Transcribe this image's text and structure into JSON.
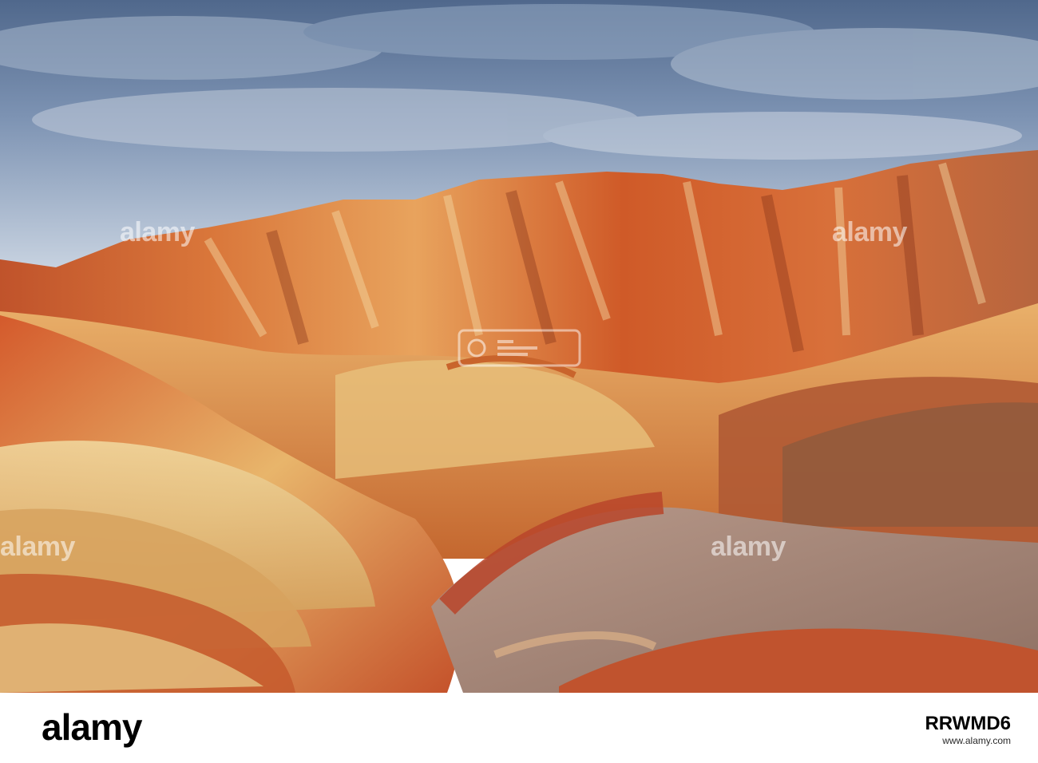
{
  "photo": {
    "subject": "rainbow-striped-badland-hills"
  },
  "watermarks": {
    "brand": "alamy"
  },
  "footer": {
    "logo": "alamy",
    "caption": "www.alamy.com",
    "image_id": "RRWMD6"
  },
  "colors": {
    "sky_top": "#4f6f97",
    "sky_bottom": "#c9d4e2",
    "rock_red": "#c94e24",
    "rock_orange": "#e58e43",
    "rock_cream": "#e8c98c",
    "rock_grey": "#a98e82"
  }
}
